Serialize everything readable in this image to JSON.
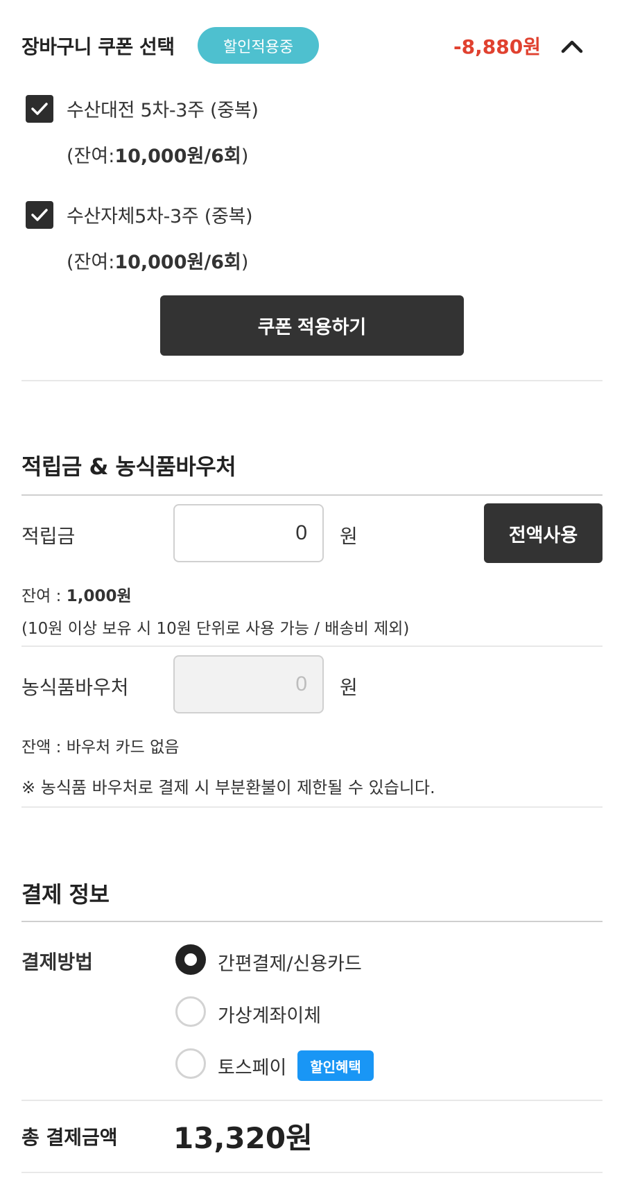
{
  "coupon": {
    "title": "장바구니 쿠폰 선택",
    "status_pill": "할인적용중",
    "discount": "-8,880원",
    "items": [
      {
        "name": "수산대전 5차-3주 (중복)",
        "remain_prefix": "(잔여:",
        "remain_value": "10,000원/6회",
        "remain_suffix": ")",
        "checked": true
      },
      {
        "name": "수산자체5차-3주 (중복)",
        "remain_prefix": "(잔여:",
        "remain_value": "10,000원/6회",
        "remain_suffix": ")",
        "checked": true
      }
    ],
    "apply_label": "쿠폰 적용하기"
  },
  "points": {
    "title": "적립금 & 농식품바우처",
    "points_label": "적립금",
    "points_value": "0",
    "unit": "원",
    "use_all_label": "전액사용",
    "balance_prefix": "잔여 : ",
    "balance_value": "1,000원",
    "note": "(10원 이상 보유 시 10원 단위로 사용 가능 / 배송비 제외)",
    "voucher_label": "농식품바우처",
    "voucher_value": "0",
    "voucher_balance": "잔액 : 바우처 카드 없음",
    "voucher_notice": "※ 농식품 바우처로 결제 시 부분환불이 제한될 수 있습니다."
  },
  "payment": {
    "title": "결제 정보",
    "method_label": "결제방법",
    "methods": [
      {
        "label": "간편결제/신용카드",
        "selected": true
      },
      {
        "label": "가상계좌이체",
        "selected": false
      },
      {
        "label": "토스페이",
        "selected": false,
        "badge": "할인혜택"
      }
    ],
    "total_label": "총 결제금액",
    "total_value": "13,320원"
  },
  "colors": {
    "accent_pill": "#4ec0cf",
    "discount": "#e0412f",
    "badge": "#1996f5",
    "dark_button": "#333333"
  },
  "icons": [
    "chevron-up-icon",
    "checkmark-icon"
  ]
}
